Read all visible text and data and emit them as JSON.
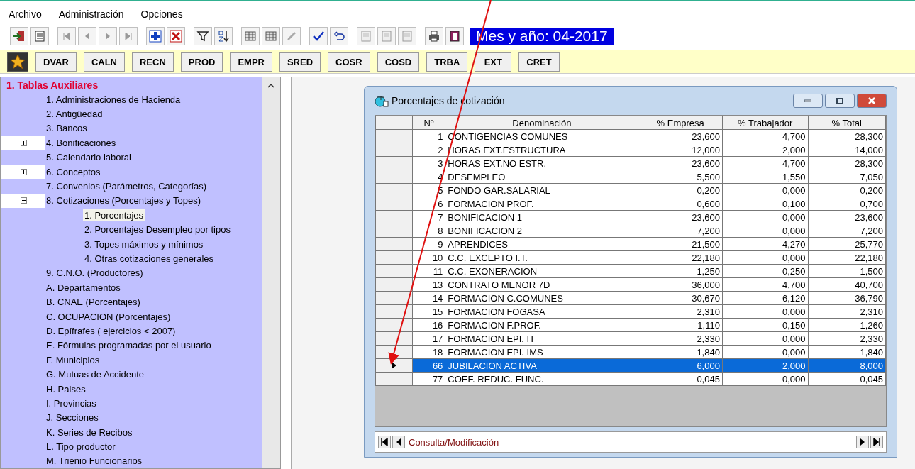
{
  "menu": [
    "Archivo",
    "Administración",
    "Opciones"
  ],
  "period": "Mes y año: 04-2017",
  "shortcuts": [
    "DVAR",
    "CALN",
    "RECN",
    "PROD",
    "EMPR",
    "SRED",
    "COSR",
    "COSD",
    "TRBA",
    "EXT",
    "CRET"
  ],
  "sidebar": {
    "title": "1. Tablas Auxiliares",
    "items": [
      {
        "label": "1. Administraciones de Hacienda",
        "selected": false
      },
      {
        "label": "2. Antigüedad",
        "selected": false
      },
      {
        "label": "3. Bancos",
        "selected": false
      },
      {
        "label": "4. Bonificaciones",
        "selected": false,
        "expanded": false
      },
      {
        "label": "5. Calendario laboral",
        "selected": false
      },
      {
        "label": "6. Conceptos",
        "selected": false,
        "expanded": false
      },
      {
        "label": "7. Convenios (Parámetros, Categorías)",
        "selected": false
      },
      {
        "label": "8. Cotizaciones (Porcentajes y Topes)",
        "selected": false,
        "expanded": true,
        "children": [
          {
            "label": "1. Porcentajes",
            "selected": true
          },
          {
            "label": "2. Porcentajes Desempleo por tipos",
            "selected": false
          },
          {
            "label": "3. Topes máximos y mínimos",
            "selected": false
          },
          {
            "label": "4. Otras cotizaciones generales",
            "selected": false
          }
        ]
      },
      {
        "label": "9. C.N.O. (Productores)",
        "selected": false
      },
      {
        "label": "A. Departamentos",
        "selected": false
      },
      {
        "label": "B. CNAE (Porcentajes)",
        "selected": false
      },
      {
        "label": "C. OCUPACION (Porcentajes)",
        "selected": false
      },
      {
        "label": "D. Epífrafes ( ejercicios < 2007)",
        "selected": false
      },
      {
        "label": "E. Fórmulas programadas por el usuario",
        "selected": false
      },
      {
        "label": "F. Municipios",
        "selected": false
      },
      {
        "label": "G. Mutuas de Accidente",
        "selected": false
      },
      {
        "label": "H. Paises",
        "selected": false
      },
      {
        "label": "I. Provincias",
        "selected": false
      },
      {
        "label": "J. Secciones",
        "selected": false
      },
      {
        "label": "K. Series de Recibos",
        "selected": false
      },
      {
        "label": "L. Tipo productor",
        "selected": false
      },
      {
        "label": "M. Trienio Funcionarios",
        "selected": false
      }
    ]
  },
  "dialog": {
    "title": "Porcentajes de cotización",
    "columns": [
      "Nº",
      "Denominación",
      "% Empresa",
      "% Trabajador",
      "% Total"
    ],
    "rows": [
      {
        "selected": false,
        "cells": [
          "1",
          "CONTIGENCIAS COMUNES",
          "23,600",
          "4,700",
          "28,300"
        ]
      },
      {
        "selected": false,
        "cells": [
          "2",
          "HORAS EXT.ESTRUCTURA",
          "12,000",
          "2,000",
          "14,000"
        ]
      },
      {
        "selected": false,
        "cells": [
          "3",
          "HORAS EXT.NO ESTR.",
          "23,600",
          "4,700",
          "28,300"
        ]
      },
      {
        "selected": false,
        "cells": [
          "4",
          "DESEMPLEO",
          "5,500",
          "1,550",
          "7,050"
        ]
      },
      {
        "selected": false,
        "cells": [
          "5",
          "FONDO GAR.SALARIAL",
          "0,200",
          "0,000",
          "0,200"
        ]
      },
      {
        "selected": false,
        "cells": [
          "6",
          "FORMACION PROF.",
          "0,600",
          "0,100",
          "0,700"
        ]
      },
      {
        "selected": false,
        "cells": [
          "7",
          "BONIFICACION 1",
          "23,600",
          "0,000",
          "23,600"
        ]
      },
      {
        "selected": false,
        "cells": [
          "8",
          "BONIFICACION 2",
          "7,200",
          "0,000",
          "7,200"
        ]
      },
      {
        "selected": false,
        "cells": [
          "9",
          "APRENDICES",
          "21,500",
          "4,270",
          "25,770"
        ]
      },
      {
        "selected": false,
        "cells": [
          "10",
          "C.C. EXCEPTO I.T.",
          "22,180",
          "0,000",
          "22,180"
        ]
      },
      {
        "selected": false,
        "cells": [
          "11",
          "C.C. EXONERACION",
          "1,250",
          "0,250",
          "1,500"
        ]
      },
      {
        "selected": false,
        "cells": [
          "13",
          "CONTRATO MENOR  7D",
          "36,000",
          "4,700",
          "40,700"
        ]
      },
      {
        "selected": false,
        "cells": [
          "14",
          "FORMACION C.COMUNES",
          "30,670",
          "6,120",
          "36,790"
        ]
      },
      {
        "selected": false,
        "cells": [
          "15",
          "FORMACION FOGASA",
          "2,310",
          "0,000",
          "2,310"
        ]
      },
      {
        "selected": false,
        "cells": [
          "16",
          "FORMACION F.PROF.",
          "1,110",
          "0,150",
          "1,260"
        ]
      },
      {
        "selected": false,
        "cells": [
          "17",
          "FORMACION EPI. IT",
          "2,330",
          "0,000",
          "2,330"
        ]
      },
      {
        "selected": false,
        "cells": [
          "18",
          "FORMACION EPI. IMS",
          "1,840",
          "0,000",
          "1,840"
        ]
      },
      {
        "selected": true,
        "cells": [
          "66",
          "JUBILACION ACTIVA",
          "6,000",
          "2,000",
          "8,000"
        ]
      },
      {
        "selected": false,
        "cells": [
          "77",
          "COEF. REDUC. FUNC.",
          "0,045",
          "0,000",
          "0,045"
        ]
      }
    ],
    "status": "Consulta/Modificación"
  }
}
